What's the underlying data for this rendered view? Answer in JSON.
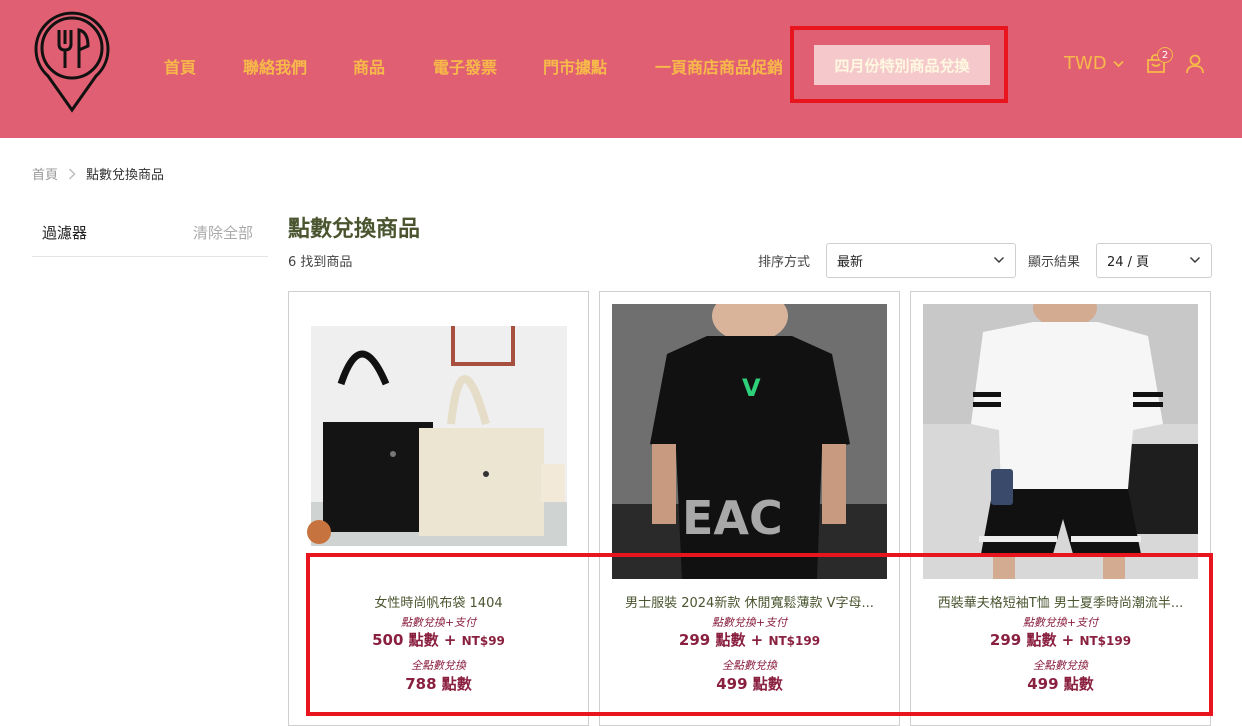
{
  "header": {
    "nav": [
      "首頁",
      "聯絡我們",
      "商品",
      "電子發票",
      "門市據點",
      "一頁商店商品促銷"
    ],
    "special_nav": "四月份特別商品兌換",
    "currency": "TWD",
    "cart_count": "2",
    "colors": {
      "background": "#e05f72",
      "nav_text": "#f6b94a",
      "highlight": "#e8141e"
    }
  },
  "breadcrumb": {
    "home": "首頁",
    "current": "點數兌換商品"
  },
  "sidebar": {
    "filter_title": "過濾器",
    "clear_all": "清除全部"
  },
  "main": {
    "title": "點數兌換商品",
    "found": "6 找到商品",
    "sort_label": "排序方式",
    "sort_value": "最新",
    "show_label": "顯示結果",
    "show_value": "24 / 頁"
  },
  "products": [
    {
      "name": "女性時尚帆布袋 1404",
      "label_mixed": "點數兌換+支付",
      "mixed_points": "500 點數 + ",
      "mixed_cash": "NT$99",
      "label_full": "全點數兌換",
      "full_points": "788 點數"
    },
    {
      "name": "男士服裝 2024新款 休閒寬鬆薄款 V字母...",
      "label_mixed": "點數兌換+支付",
      "mixed_points": "299 點數 + ",
      "mixed_cash": "NT$199",
      "label_full": "全點數兌換",
      "full_points": "499 點數"
    },
    {
      "name": "西裝華夫格短袖T恤 男士夏季時尚潮流半...",
      "label_mixed": "點數兌換+支付",
      "mixed_points": "299 點數 + ",
      "mixed_cash": "NT$199",
      "label_full": "全點數兌換",
      "full_points": "499 點數"
    }
  ]
}
